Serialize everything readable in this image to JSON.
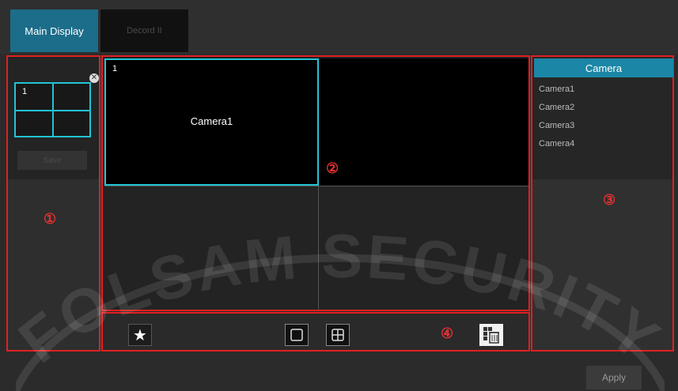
{
  "tabs": [
    {
      "label": "Main Display",
      "active": true
    },
    {
      "label": "Decord II",
      "active": false
    }
  ],
  "left_panel": {
    "layout_thumb_label": "1",
    "save_label": "Save",
    "marker": "①"
  },
  "grid": {
    "cells": [
      {
        "number": "1",
        "camera": "Camera1",
        "selected": true
      },
      {
        "number": "",
        "camera": ""
      },
      {
        "number": "",
        "camera": ""
      },
      {
        "number": "",
        "camera": ""
      }
    ],
    "marker": "②"
  },
  "camera_panel": {
    "header": "Camera",
    "cameras": [
      "Camera1",
      "Camera2",
      "Camera3",
      "Camera4"
    ],
    "marker": "③"
  },
  "toolbar": {
    "marker": "④",
    "icons": [
      "star-icon",
      "single-screen-icon",
      "quad-screen-icon",
      "clear-all-icon"
    ]
  },
  "apply_label": "Apply",
  "watermark": "FOLSAM SECURITY",
  "colors": {
    "accent": "#1c86a6",
    "selection": "#22c3d4",
    "region_outline": "#e02020"
  }
}
